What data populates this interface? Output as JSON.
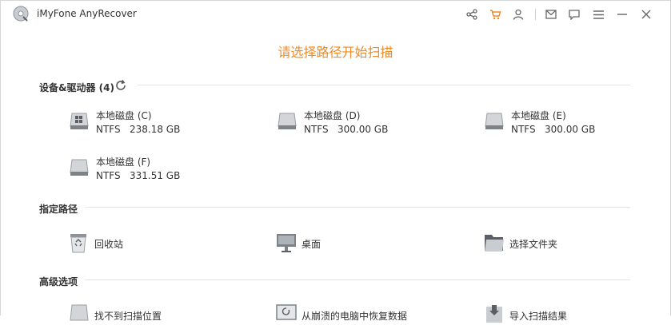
{
  "app": {
    "title": "iMyFone AnyRecover"
  },
  "toolbar": {
    "icons": [
      "share-icon",
      "cart-icon",
      "user-icon",
      "mail-icon",
      "feedback-icon",
      "menu-icon",
      "minimize-icon",
      "close-icon"
    ],
    "accent": "#f08a24"
  },
  "main": {
    "heading": "请选择路径开始扫描"
  },
  "sections": {
    "devices": {
      "title": "设备&驱动器 (4)",
      "drives": [
        {
          "name": "本地磁盘 (C)",
          "fs": "NTFS",
          "size": "238.18 GB",
          "system": true
        },
        {
          "name": "本地磁盘 (D)",
          "fs": "NTFS",
          "size": "300.00 GB",
          "system": false
        },
        {
          "name": "本地磁盘 (E)",
          "fs": "NTFS",
          "size": "300.00 GB",
          "system": false
        },
        {
          "name": "本地磁盘 (F)",
          "fs": "NTFS",
          "size": "331.51 GB",
          "system": false
        }
      ]
    },
    "paths": {
      "title": "指定路径",
      "items": [
        {
          "label": "回收站",
          "icon": "recycle-bin-icon"
        },
        {
          "label": "桌面",
          "icon": "desktop-icon"
        },
        {
          "label": "选择文件夹",
          "icon": "folder-icon"
        }
      ]
    },
    "advanced": {
      "title": "高级选项",
      "items": [
        {
          "label": "找不到扫描位置",
          "icon": "drive-icon"
        },
        {
          "label": "从崩溃的电脑中恢复数据",
          "icon": "crashed-pc-icon"
        },
        {
          "label": "导入扫描结果",
          "icon": "import-icon"
        }
      ]
    }
  }
}
